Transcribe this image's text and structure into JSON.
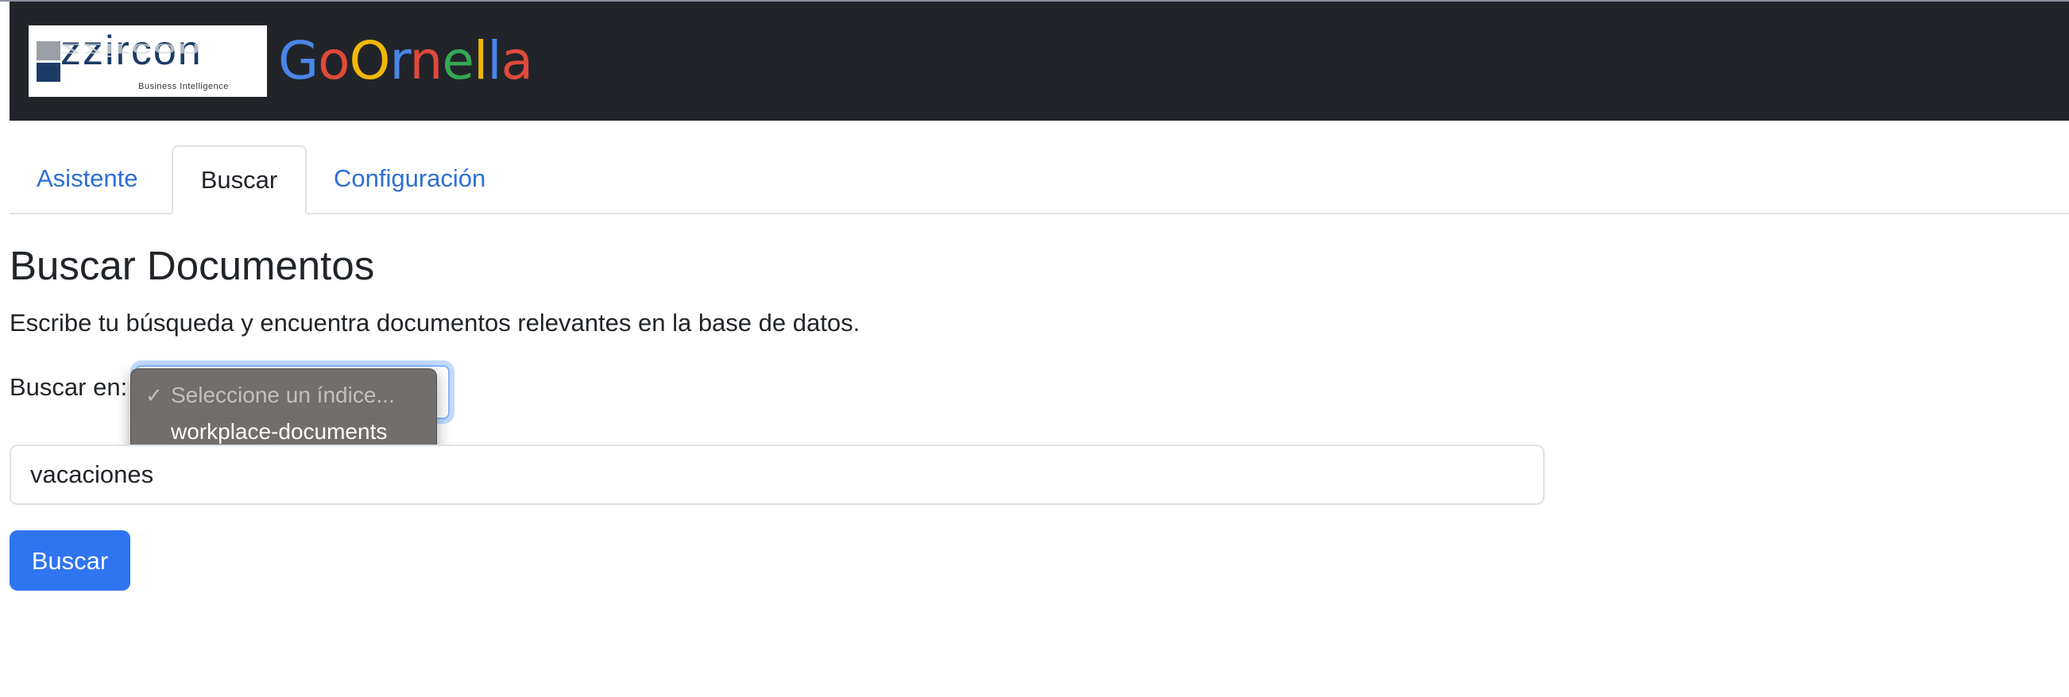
{
  "header": {
    "logo": {
      "wordmark": "zzircon",
      "tagline": "Business Intelligence"
    },
    "brand_letters": [
      {
        "char": "G",
        "color": "#4a86e8"
      },
      {
        "char": "o",
        "color": "#e0493a"
      },
      {
        "char": "O",
        "color": "#f2b705"
      },
      {
        "char": "r",
        "color": "#4a86e8"
      },
      {
        "char": "n",
        "color": "#e0493a"
      },
      {
        "char": "e",
        "color": "#35a853"
      },
      {
        "char": "l",
        "color": "#f2b705"
      },
      {
        "char": "l",
        "color": "#4a86e8"
      },
      {
        "char": "a",
        "color": "#e0493a"
      }
    ],
    "background_color": "#212529"
  },
  "tabs": [
    {
      "label": "Asistente",
      "active": false
    },
    {
      "label": "Buscar",
      "active": true
    },
    {
      "label": "Configuración",
      "active": false
    }
  ],
  "main": {
    "title": "Buscar Documentos",
    "description": "Escribe tu búsqueda y encuentra documentos relevantes en la base de datos.",
    "index_label": "Buscar en:",
    "index_select": {
      "options": [
        {
          "label": "Seleccione un índice...",
          "checked": true,
          "check_glyph": "✓"
        },
        {
          "label": "workplace-documents",
          "checked": false,
          "check_glyph": ""
        }
      ]
    },
    "query_value": "vacaciones",
    "search_button_label": "Buscar"
  },
  "colors": {
    "link": "#2b6fd6",
    "primary_button": "#2f74f0"
  }
}
